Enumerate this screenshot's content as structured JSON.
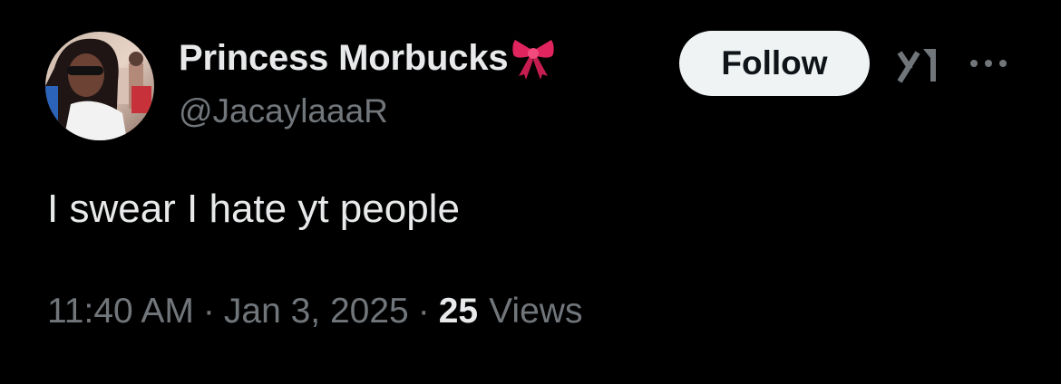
{
  "author": {
    "display_name": "Princess Morbucks",
    "name_emoji": "ribbon-emoji",
    "handle": "@JacaylaaaR",
    "avatar": "profile-photo"
  },
  "actions": {
    "follow_label": "Follow",
    "grok_icon": "grok-icon",
    "more_icon": "more-options-icon"
  },
  "tweet": {
    "text": "I swear I hate yt people"
  },
  "meta": {
    "time": "11:40 AM",
    "separator": "·",
    "date": "Jan 3, 2025",
    "views_count": "25",
    "views_label": "Views"
  },
  "colors": {
    "background": "#000000",
    "primary_text": "#e7e9ea",
    "secondary_text": "#71767b",
    "follow_bg": "#eff3f4",
    "follow_text": "#0f1419",
    "ribbon": "#e0245e"
  }
}
